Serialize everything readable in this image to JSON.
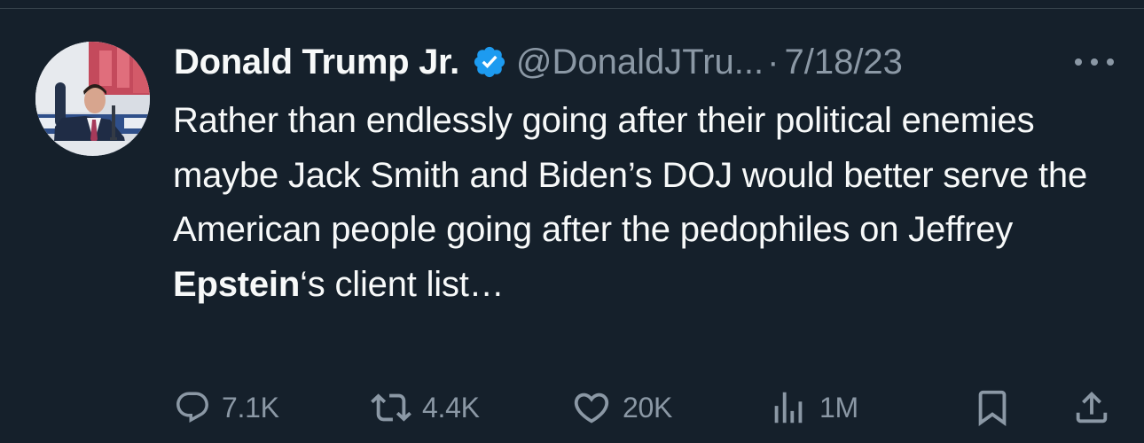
{
  "tweet": {
    "author": {
      "display_name": "Donald Trump Jr.",
      "handle": "@DonaldJTru...",
      "verified": true
    },
    "separator": "·",
    "date": "7/18/23",
    "text": {
      "part1": "Rather than endlessly going after their political enemies maybe Jack Smith and Biden’s DOJ would better serve the American people going after the pedophiles on Jeffrey ",
      "highlight": "Epstein",
      "part2": "‘s client list…"
    },
    "stats": {
      "replies": "7.1K",
      "reposts": "4.4K",
      "likes": "20K",
      "views": "1M"
    }
  },
  "colors": {
    "background": "#15202b",
    "text": "#f7f9f9",
    "secondary": "#8b98a5",
    "verified": "#1d9bf0"
  },
  "icons": {
    "verified": "verified-badge-icon",
    "more": "more-options-icon",
    "reply": "reply-icon",
    "repost": "repost-icon",
    "like": "heart-icon",
    "views": "analytics-icon",
    "bookmark": "bookmark-icon",
    "share": "share-icon"
  }
}
